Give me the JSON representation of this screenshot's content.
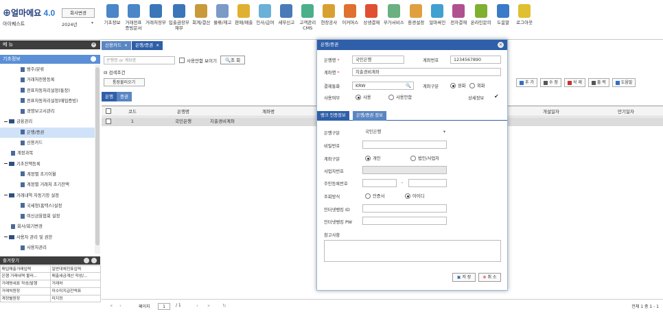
{
  "app": {
    "logo_text": "얼마에요",
    "version": "4.0",
    "company_name": "아이퀘스트",
    "change_company_label": "회사변경",
    "year": "2024년"
  },
  "top_menu": [
    {
      "label": "기초정보",
      "color": "#4a86c8"
    },
    {
      "label": "거래전표\n증빙문서",
      "color": "#4a86c8"
    },
    {
      "label": "거래처장부",
      "color": "#3a76b8"
    },
    {
      "label": "입출금장부\n재무",
      "color": "#3a76b8"
    },
    {
      "label": "회계/결산",
      "color": "#c89a3a"
    },
    {
      "label": "물류/재고",
      "color": "#7a9ac8"
    },
    {
      "label": "판매/매출",
      "color": "#e0b030"
    },
    {
      "label": "인사/급여",
      "color": "#6ab0d8"
    },
    {
      "label": "세무신고",
      "color": "#4a7ab8"
    },
    {
      "label": "고객관리\nCMS",
      "color": "#4ab08a"
    },
    {
      "label": "현장공사",
      "color": "#d8a030"
    },
    {
      "label": "이커머스",
      "color": "#e07030"
    },
    {
      "label": "상생결제",
      "color": "#e05030"
    },
    {
      "label": "부가서비스",
      "color": "#6ab080"
    },
    {
      "label": "환경설정",
      "color": "#e0a040"
    },
    {
      "label": "얼마싸인",
      "color": "#40a0d0"
    },
    {
      "label": "전자결재",
      "color": "#b05090"
    },
    {
      "label": "온라인문의",
      "color": "#80b030"
    },
    {
      "label": "도움말",
      "color": "#3a7ac8"
    },
    {
      "label": "로그아웃",
      "color": "#e0c030"
    }
  ],
  "left_menu": {
    "header": "메 뉴",
    "section": "기초정보",
    "items": [
      {
        "label": "범주/분류",
        "type": "doc",
        "indent": 30,
        "selected": false
      },
      {
        "label": "거래처전용등록",
        "type": "doc",
        "indent": 30,
        "selected": false
      },
      {
        "label": "전표자동처리설정(통장)",
        "type": "doc",
        "indent": 30,
        "selected": false
      },
      {
        "label": "전표자동처리설정(매입증빙)",
        "type": "doc",
        "indent": 30,
        "selected": false
      },
      {
        "label": "경영보고서관리",
        "type": "doc",
        "indent": 30,
        "selected": false
      },
      {
        "label": "금융관리",
        "type": "folder",
        "indent": 6,
        "selected": false
      },
      {
        "label": "은행/증권",
        "type": "doc",
        "indent": 30,
        "selected": true
      },
      {
        "label": "신용카드",
        "type": "doc",
        "indent": 30,
        "selected": false
      },
      {
        "label": "계정과목",
        "type": "doc",
        "indent": 16,
        "selected": false
      },
      {
        "label": "기초잔액등록",
        "type": "folder",
        "indent": 6,
        "selected": false
      },
      {
        "label": "계정별 초기이월",
        "type": "doc",
        "indent": 30,
        "selected": false
      },
      {
        "label": "계정별 거래처 초기잔액",
        "type": "doc",
        "indent": 30,
        "selected": false
      },
      {
        "label": "거래내역 자동기장 설정",
        "type": "folder",
        "indent": 6,
        "selected": false
      },
      {
        "label": "국세청(홈택스)설정",
        "type": "doc",
        "indent": 30,
        "selected": false
      },
      {
        "label": "여신금융협회 설정",
        "type": "doc",
        "indent": 30,
        "selected": false
      },
      {
        "label": "회사/회기변경",
        "type": "doc",
        "indent": 16,
        "selected": false
      },
      {
        "label": "사용자 관리 및 권한",
        "type": "folder",
        "indent": 6,
        "selected": false
      },
      {
        "label": "사용자관리",
        "type": "doc",
        "indent": 30,
        "selected": false
      }
    ]
  },
  "favorites": {
    "header": "즐겨찾기",
    "items": [
      "매입매출거래입력",
      "일반대체전표입력",
      "은행 거래내역 불러...",
      "매출세금계산 작성/...",
      "거래명세표 작성/발행",
      "거래처",
      "거래처원장",
      "미수미지급잔액표",
      "계정별원장",
      "미지정"
    ]
  },
  "tabs": [
    {
      "label": "신용카드",
      "active": false
    },
    {
      "label": "은행/증권",
      "active": true
    }
  ],
  "search": {
    "placeholder": "은행명 or 계좌명",
    "show_unused_label": "사용안함 보이기",
    "search_button": "조 회",
    "conditions_label": "검색조건",
    "load_button": "통장불러오기"
  },
  "subtabs": [
    {
      "label": "은행",
      "active": true
    },
    {
      "label": "증권",
      "active": false
    }
  ],
  "toolbar": [
    {
      "label": "추 가",
      "icon": "plus-icon",
      "color": "#2f6fc8"
    },
    {
      "label": "수 정",
      "icon": "edit-icon",
      "color": "#555"
    },
    {
      "label": "삭 제",
      "icon": "trash-icon",
      "color": "#c83030"
    },
    {
      "label": "출 력",
      "icon": "print-icon",
      "color": "#555"
    },
    {
      "label": "도움말",
      "icon": "help-icon",
      "color": "#2f6fc8"
    }
  ],
  "grid": {
    "columns": [
      "코드",
      "은행명",
      "계좌명",
      "개설일자",
      "만기일자"
    ],
    "rows": [
      {
        "code": "1",
        "bank": "국민은행",
        "account": "지출경비계좌",
        "open": "",
        "due": ""
      }
    ]
  },
  "pager": {
    "page_label": "페이지",
    "page": "1",
    "total_pages": "/ 1",
    "total": "전체 1 중 1 - 1"
  },
  "modal": {
    "title": "은행/증권",
    "bank_label": "은행명",
    "bank_value": "국민은행",
    "acct_no_label": "계좌번호",
    "acct_no_value": "1234567890",
    "acct_name_label": "계좌명",
    "acct_name_value": "지출경비계좌",
    "currency_label": "결제통화",
    "currency_value": "KRW",
    "acct_type_label": "계좌구분",
    "acct_type_opt1": "원화",
    "acct_type_opt2": "외화",
    "use_label": "사용여부",
    "use_opt1": "사용",
    "use_opt2": "사용안함",
    "detail_label": "상세정보",
    "tab1": "뱅크 인증정보",
    "tab2": "은행/증권 정보",
    "bank_type_label": "은행구분",
    "bank_type_value": "국민은행",
    "password_label": "비밀번호",
    "acct_class_label": "계좌구분",
    "acct_class_opt1": "개인",
    "acct_class_opt2": "법인/사업자",
    "bizno_label": "사업자번호",
    "rrn_label": "주민등록번호",
    "rrn_sep": "-",
    "lookup_label": "조회방식",
    "lookup_opt1": "인증서",
    "lookup_opt2": "아이디",
    "ib_id_label": "인터넷뱅킹 ID",
    "ib_pw_label": "인터넷뱅킹 PW",
    "memo_label": "참고사항",
    "save": "저 장",
    "cancel": "취 소"
  }
}
